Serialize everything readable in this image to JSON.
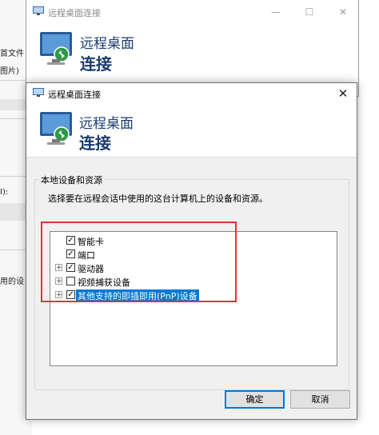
{
  "background_app": {
    "menu_fragment": "首文件",
    "toolbar_fragment": "图片)",
    "label_fragment": "I):",
    "text_fragment": "用的设"
  },
  "back_window": {
    "title": "远程桌面连接",
    "banner_line1": "远程桌面",
    "banner_line2": "连接",
    "minimize_symbol": "—",
    "maximize_symbol": "☐",
    "close_symbol": "✕"
  },
  "dialog": {
    "title": "远程桌面连接",
    "close_symbol": "✕",
    "banner_line1": "远程桌面",
    "banner_line2": "连接",
    "group_title": "本地设备和资源",
    "description": "选择要在远程会话中使用的这台计算机上的设备和资源。",
    "tree": [
      {
        "label": "智能卡",
        "checked": true,
        "has_expander": false,
        "selected": false
      },
      {
        "label": "端口",
        "checked": true,
        "has_expander": false,
        "selected": false
      },
      {
        "label": "驱动器",
        "checked": true,
        "has_expander": true,
        "selected": false
      },
      {
        "label": "视频捕获设备",
        "checked": false,
        "has_expander": true,
        "selected": false
      },
      {
        "label": "其他支持的即插即用(PnP)设备",
        "checked": true,
        "has_expander": true,
        "selected": true
      }
    ],
    "expander_symbol": "+",
    "check_symbol": "✓",
    "ok_label": "确定",
    "cancel_label": "取消"
  },
  "colors": {
    "highlight_box": "#e1323a",
    "selection": "#0078d7",
    "banner_text": "#1a3b6e"
  }
}
